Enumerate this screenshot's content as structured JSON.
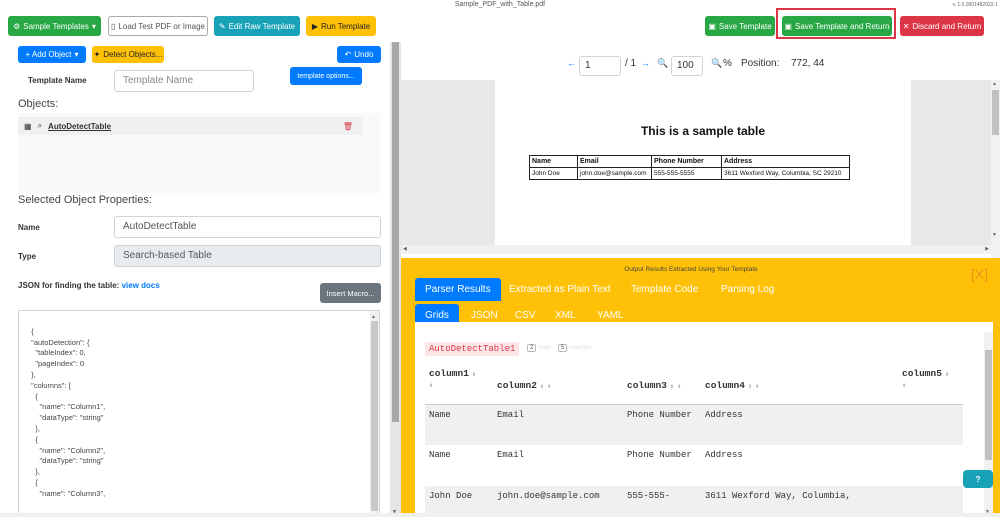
{
  "window": {
    "title": "Sample_PDF_with_Table.pdf",
    "version": "v. 1.0.0001482022-1"
  },
  "toolbar": {
    "sample_templates": "Sample Templates",
    "load_test_pdf": "Load Test PDF or Image",
    "edit_raw_template": "Edit Raw Template",
    "run_template": "Run Template",
    "save_template": "Save Template",
    "save_and_return": "Save Template and Return",
    "discard_and_return": "Discard and Return"
  },
  "left": {
    "add_object": "+ Add Object",
    "detect_objects": "Detect Objects...",
    "undo": "Undo",
    "template_name_label": "Template Name",
    "template_name_placeholder": "Template Name",
    "template_options": "template options...",
    "objects_heading": "Objects:",
    "objects": [
      {
        "name": "AutoDetectTable"
      }
    ],
    "selected_heading": "Selected Object Properties:",
    "name_label": "Name",
    "name_value": "AutoDetectTable",
    "type_label": "Type",
    "type_value": "Search-based Table",
    "json_label": "JSON for finding the table:",
    "view_docs": "view docs",
    "insert_macro": "Insert Macro...",
    "json_text": "{\n  \"autoDetection\": {\n    \"tableIndex\": 0,\n    \"pageIndex\": 0\n  },\n  \"columns\": [\n    {\n      \"name\": \"Column1\",\n      \"dataType\": \"string\"\n    },\n    {\n      \"name\": \"Column2\",\n      \"dataType\": \"string\"\n    },\n    {\n      \"name\": \"Column3\","
  },
  "viewer": {
    "page": "1",
    "page_total": "/ 1",
    "zoom": "100",
    "zoom_unit": "%",
    "position_label": "Position:",
    "position_value": "772, 44",
    "pdf_title": "This is a sample table",
    "pdf_table": [
      [
        "Name",
        "Email",
        "Phone Number",
        "Address"
      ],
      [
        "John Doe",
        "john.doe@sample.com",
        "555-555-5555",
        "3611 Wexford Way, Columbia, SC 29210"
      ]
    ]
  },
  "results": {
    "title": "Output Results Extracted Using Your Template",
    "close": "[X]",
    "tabs": [
      "Parser Results",
      "Extracted as Plain Text",
      "Template Code",
      "Parsing Log"
    ],
    "subtabs": [
      "Grids",
      "JSON",
      "CSV",
      "XML",
      "YAML"
    ],
    "grid_name": "AutoDetectTable1",
    "rows_count": "2",
    "rows_label": "rows",
    "cols_count": "5",
    "cols_label": "columns",
    "columns": [
      "column1",
      "column2",
      "column3",
      "column4",
      "column5"
    ],
    "rows": [
      [
        "Name",
        "Email",
        "Phone Number",
        "Address",
        ""
      ],
      [
        "Name",
        "Email",
        "Phone Number",
        "Address",
        ""
      ],
      [
        "John Doe",
        "john.doe@sample.com",
        "555-555-",
        "3611 Wexford Way, Columbia,",
        ""
      ]
    ],
    "help": "?"
  }
}
